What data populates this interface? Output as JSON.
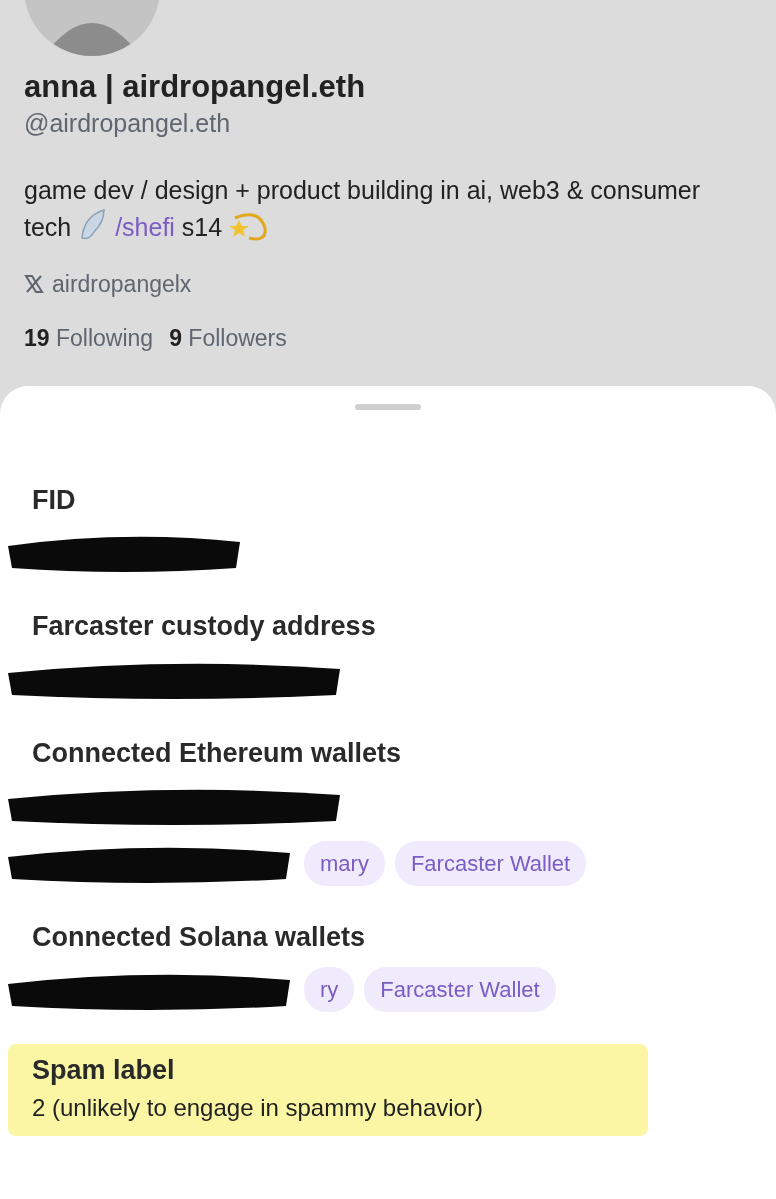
{
  "profile": {
    "display_name": "anna | airdropangel.eth",
    "handle": "@airdropangel.eth",
    "bio": {
      "text_before": "game dev / design + product  building in ai, web3 & consumer tech",
      "link": "/shefi",
      "text_after": "s14"
    },
    "x_account": "airdropangelx",
    "following_count": "19",
    "following_label": "Following",
    "followers_count": "9",
    "followers_label": "Followers"
  },
  "sheet": {
    "sections": [
      {
        "title": "FID",
        "rows": [
          {
            "redacted": true,
            "badges": []
          }
        ]
      },
      {
        "title": "Farcaster custody address",
        "rows": [
          {
            "redacted": true,
            "badges": []
          }
        ]
      },
      {
        "title": "Connected Ethereum wallets",
        "rows": [
          {
            "redacted": true,
            "badges": []
          },
          {
            "redacted": true,
            "badges": [
              "mary",
              "Farcaster Wallet"
            ]
          }
        ]
      },
      {
        "title": "Connected Solana wallets",
        "rows": [
          {
            "redacted": true,
            "badges": [
              "ry",
              "Farcaster Wallet"
            ]
          }
        ]
      },
      {
        "title": "Spam label",
        "highlighted": true,
        "value": "2 (unlikely to engage in spammy behavior)"
      }
    ]
  }
}
